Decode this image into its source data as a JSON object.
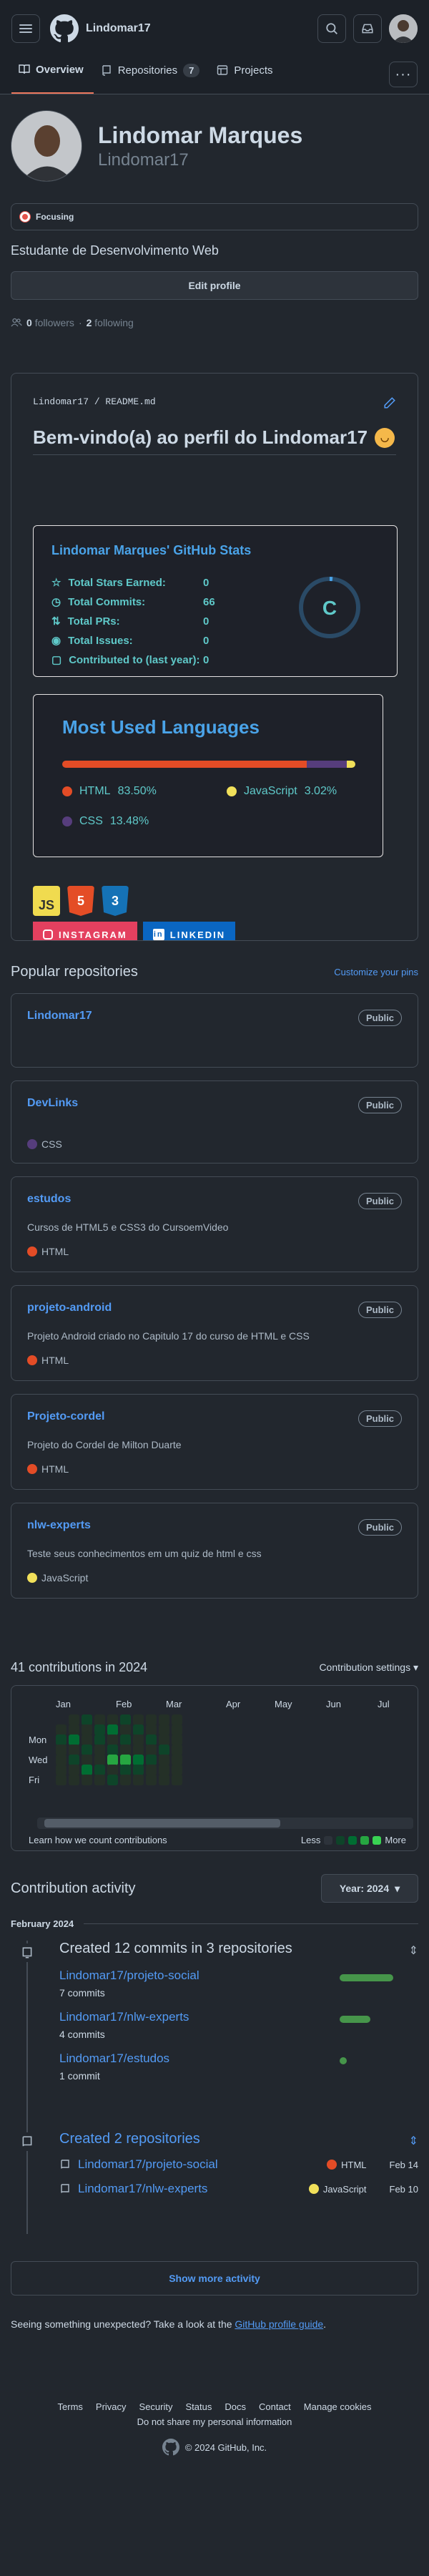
{
  "header": {
    "username": "Lindomar17"
  },
  "tabs": [
    {
      "label": "Overview"
    },
    {
      "label": "Repositories",
      "count": "7"
    },
    {
      "label": "Projects"
    }
  ],
  "profile": {
    "full_name": "Lindomar Marques",
    "login": "Lindomar17",
    "status": "Focusing",
    "bio": "Estudante de Desenvolvimento Web",
    "edit_label": "Edit profile",
    "followers_count": "0",
    "followers_label": "followers",
    "following_count": "2",
    "following_label": "following"
  },
  "readme": {
    "path_user": "Lindomar17",
    "path_file": "README.md",
    "title": "Bem-vindo(a) ao perfil do Lindomar17",
    "stats": {
      "title": "Lindomar Marques' GitHub Stats",
      "rows": [
        {
          "label": "Total Stars Earned:",
          "value": "0"
        },
        {
          "label": "Total Commits:",
          "value": "66"
        },
        {
          "label": "Total PRs:",
          "value": "0"
        },
        {
          "label": "Total Issues:",
          "value": "0"
        },
        {
          "label": "Contributed to (last year):",
          "value": "0"
        }
      ],
      "rank": "C"
    },
    "languages": {
      "title": "Most Used Languages",
      "items": [
        {
          "name": "HTML",
          "percent": "83.50%",
          "value": 83.5,
          "color": "#e34c26"
        },
        {
          "name": "JavaScript",
          "percent": "3.02%",
          "value": 3.02,
          "color": "#f1e05a"
        },
        {
          "name": "CSS",
          "percent": "13.48%",
          "value": 13.48,
          "color": "#563d7c"
        }
      ]
    },
    "tech_badges": [
      "JS",
      "5",
      "3"
    ],
    "social": [
      {
        "label": "INSTAGRAM",
        "color": "#e4405f"
      },
      {
        "label": "LINKEDIN",
        "color": "#0a66c2"
      }
    ]
  },
  "popular": {
    "title": "Popular repositories",
    "customize": "Customize your pins",
    "repos": [
      {
        "name": "Lindomar17",
        "visibility": "Public",
        "desc": "",
        "lang": "",
        "lang_color": ""
      },
      {
        "name": "DevLinks",
        "visibility": "Public",
        "desc": "",
        "lang": "CSS",
        "lang_color": "#563d7c"
      },
      {
        "name": "estudos",
        "visibility": "Public",
        "desc": "Cursos de HTML5 e CSS3 do CursoemVideo",
        "lang": "HTML",
        "lang_color": "#e34c26"
      },
      {
        "name": "projeto-android",
        "visibility": "Public",
        "desc": "Projeto Android criado no Capitulo 17 do curso de HTML e CSS",
        "lang": "HTML",
        "lang_color": "#e34c26"
      },
      {
        "name": "Projeto-cordel",
        "visibility": "Public",
        "desc": "Projeto do Cordel de Milton Duarte",
        "lang": "HTML",
        "lang_color": "#e34c26"
      },
      {
        "name": "nlw-experts",
        "visibility": "Public",
        "desc": "Teste seus conhecimentos em um quiz de html e css",
        "lang": "JavaScript",
        "lang_color": "#f1e05a"
      }
    ]
  },
  "contributions": {
    "title": "41 contributions in 2024",
    "settings": "Contribution settings",
    "months": [
      "Jan",
      "Feb",
      "Mar",
      "Apr",
      "May",
      "Jun",
      "Jul"
    ],
    "days": [
      "Mon",
      "Wed",
      "Fri"
    ],
    "learn": "Learn how we count contributions",
    "less": "Less",
    "more": "More"
  },
  "activity": {
    "title": "Contribution activity",
    "year_label": "Year: 2024",
    "month_label": "February 2024",
    "commits_title": "Created 12 commits in 3 repositories",
    "commits": [
      {
        "repo": "Lindomar17/projeto-social",
        "count": "7 commits",
        "share": 0.58
      },
      {
        "repo": "Lindomar17/nlw-experts",
        "count": "4 commits",
        "share": 0.33
      },
      {
        "repo": "Lindomar17/estudos",
        "count": "1 commit",
        "share": 0.08
      }
    ],
    "created_title": "Created 2 repositories",
    "created": [
      {
        "repo": "Lindomar17/projeto-social",
        "lang": "HTML",
        "lang_color": "#e34c26",
        "date": "Feb 14"
      },
      {
        "repo": "Lindomar17/nlw-experts",
        "lang": "JavaScript",
        "lang_color": "#f1e05a",
        "date": "Feb 10"
      }
    ],
    "show_more": "Show more activity"
  },
  "unexpected": {
    "text": "Seeing something unexpected? Take a look at the ",
    "link": "GitHub profile guide",
    "end": "."
  },
  "footer": {
    "links": [
      "Terms",
      "Privacy",
      "Security",
      "Status",
      "Docs",
      "Contact",
      "Manage cookies"
    ],
    "do_not_share": "Do not share my personal information",
    "copyright": "© 2024 GitHub, Inc."
  }
}
